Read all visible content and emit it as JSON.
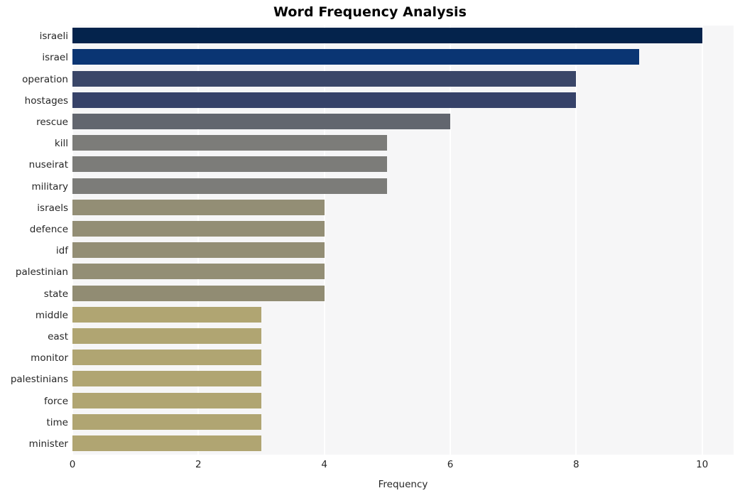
{
  "chart_data": {
    "type": "bar",
    "orientation": "horizontal",
    "title": "Word Frequency Analysis",
    "xlabel": "Frequency",
    "ylabel": "",
    "categories": [
      "israeli",
      "israel",
      "operation",
      "hostages",
      "rescue",
      "kill",
      "nuseirat",
      "military",
      "israels",
      "defence",
      "idf",
      "palestinian",
      "state",
      "middle",
      "east",
      "monitor",
      "palestinians",
      "force",
      "time",
      "minister"
    ],
    "values": [
      10,
      9,
      8,
      8,
      6,
      5,
      5,
      5,
      4,
      4,
      4,
      4,
      4,
      3,
      3,
      3,
      3,
      3,
      3,
      3
    ],
    "bar_colors": [
      "#04234c",
      "#0a3573",
      "#3a4668",
      "#364269",
      "#62666f",
      "#7c7c79",
      "#7c7c79",
      "#7c7c79",
      "#938e75",
      "#938e75",
      "#938e75",
      "#938e75",
      "#918c73",
      "#b0a572",
      "#b0a572",
      "#b0a572",
      "#b0a572",
      "#b0a572",
      "#b0a572",
      "#b0a572"
    ],
    "xlim": [
      0,
      10.5
    ],
    "xticks": [
      0,
      2,
      4,
      6,
      8,
      10
    ],
    "xtick_labels": [
      "0",
      "2",
      "4",
      "6",
      "8",
      "10"
    ],
    "grid": true,
    "grid_axis": "x",
    "grid_color": "#ffffff",
    "plot_background": "#f6f6f7",
    "figure_background": "#ffffff",
    "legend": null,
    "style": "seaborn-whitegrid"
  }
}
